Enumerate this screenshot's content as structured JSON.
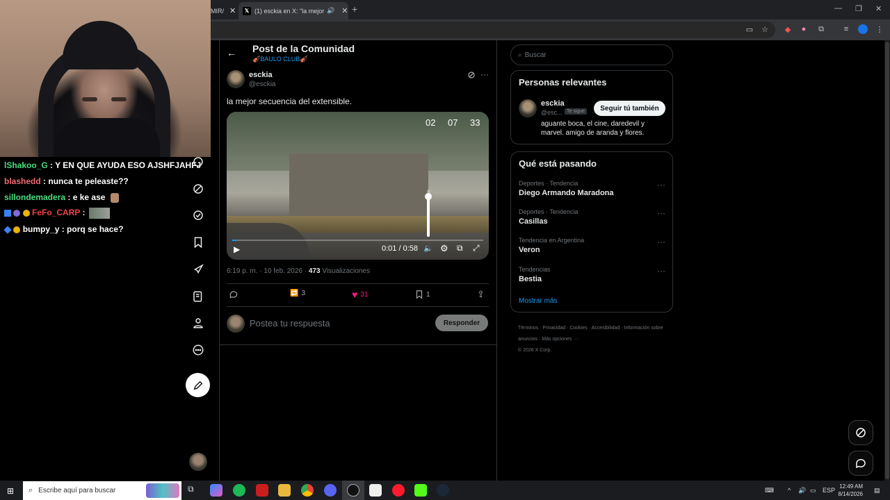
{
  "browser": {
    "tabs": [
      {
        "label": "MIR/"
      },
      {
        "label": "(1) esckia en X: \"la mejor se"
      }
    ],
    "new_tab": "+"
  },
  "chat": {
    "messages": [
      {
        "user": "lShakoo_G",
        "text": ": Y EN QUE AYUDA ESO AJSHFJAHFJ",
        "color": "#4ade80"
      },
      {
        "user": "blashedd",
        "text": ": nunca te peleaste??",
        "color": "#ef6b73"
      },
      {
        "user": "sillondemadera",
        "text": ": e ke ase",
        "color": "#4ade80"
      },
      {
        "user": "FeFo_CARP",
        "text": ":",
        "color": "#ef4444"
      },
      {
        "user": "bumpy_y",
        "text": ": porq se hace?",
        "color": "#ffffff"
      }
    ]
  },
  "header": {
    "title": "Post de la Comunidad",
    "community": "🎻BAULO CLUB🎻"
  },
  "post": {
    "display_name": "esckia",
    "handle": "@esckia",
    "text": "la mejor secuencia del extensible.",
    "video": {
      "timer": [
        "02",
        "07",
        "33"
      ],
      "time_label": "0:01 / 0:58",
      "progress": 0.017,
      "volume": 0.85
    },
    "time": "6:19 p. m.",
    "date": "10 feb. 2026",
    "views_count": "473",
    "views_label": "Visualizaciones",
    "reposts": "3",
    "likes": "31",
    "bookmarks": "1"
  },
  "reply": {
    "placeholder": "Postea tu respuesta",
    "button": "Responder"
  },
  "right": {
    "search_placeholder": "Buscar",
    "relevant": {
      "title": "Personas relevantes",
      "name": "esckia",
      "handle": "@esc...",
      "follows_badge": "Te sigue",
      "follow_button": "Seguir tú también",
      "bio": "aguante boca, el cine, daredevil y marvel. amigo de aranda y flores."
    },
    "trends": {
      "title": "Qué está pasando",
      "items": [
        {
          "category": "Deportes · Tendencia",
          "name": "Diego Armando Maradona"
        },
        {
          "category": "Deportes · Tendencia",
          "name": "Casillas"
        },
        {
          "category": "Tendencia en Argentina",
          "name": "Veron"
        },
        {
          "category": "Tendencias",
          "name": "Bestia"
        }
      ],
      "show_more": "Mostrar más"
    },
    "footer": {
      "links": [
        "Términos",
        "Privacidad",
        "Cookies",
        "Accesibilidad",
        "Información sobre anuncios",
        "Más opciones ···"
      ],
      "copyright": "© 2026 X Corp."
    }
  },
  "taskbar": {
    "search_placeholder": "Escribe aquí para buscar",
    "lang": "ESP",
    "time": "12:49 AM",
    "date": "8/14/2026"
  },
  "colors": {
    "accent": "#1d9bf0",
    "like": "#f91880",
    "background": "#000000"
  }
}
